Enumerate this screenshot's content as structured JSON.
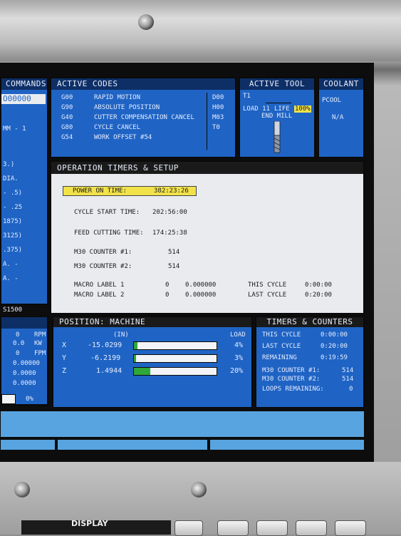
{
  "left_column": {
    "title": "COMMANDS",
    "code": "O00000",
    "lines": [
      "MM - 1",
      "3.)",
      "DIA.",
      "- .5)",
      "- .25",
      "1875)",
      "3125)",
      ".375)",
      "A. -",
      "A. -",
      "S1500"
    ]
  },
  "active_codes": {
    "title": "ACTIVE CODES",
    "rows": [
      {
        "code": "G00",
        "desc": "RAPID MOTION",
        "right": "D00"
      },
      {
        "code": "G90",
        "desc": "ABSOLUTE POSITION",
        "right": "H00"
      },
      {
        "code": "G40",
        "desc": "CUTTER COMPENSATION CANCEL",
        "right": "M03"
      },
      {
        "code": "G80",
        "desc": "CYCLE CANCEL",
        "right": "T0"
      },
      {
        "code": "G54",
        "desc": "WORK OFFSET #54",
        "right": ""
      }
    ]
  },
  "active_tool": {
    "title": "ACTIVE TOOL",
    "tool": "T1",
    "load_label": "LOAD 11",
    "life_label": "LIFE",
    "life_value": "100%",
    "tool_type": "END MILL"
  },
  "coolant": {
    "title": "COOLANT",
    "name": "PCOOL",
    "value": "N/A"
  },
  "operation": {
    "title": "OPERATION TIMERS & SETUP",
    "power_on_label": "POWER ON TIME:",
    "power_on_value": "382:23:26",
    "cycle_start_label": "CYCLE START TIME:",
    "cycle_start_value": "202:56:00",
    "feed_label": "FEED CUTTING TIME:",
    "feed_value": "174:25:38",
    "m30_1_label": "M30 COUNTER #1:",
    "m30_1_value": "514",
    "m30_2_label": "M30 COUNTER #2:",
    "m30_2_value": "514",
    "macro1_label": "MACRO LABEL 1",
    "macro1_num": "0",
    "macro1_value": "0.000000",
    "macro2_label": "MACRO LABEL 2",
    "macro2_num": "0",
    "macro2_value": "0.000000",
    "this_cycle_label": "THIS CYCLE",
    "this_cycle_value": "0:00:00",
    "last_cycle_label": "LAST CYCLE",
    "last_cycle_value": "0:20:00"
  },
  "spindle": {
    "rows": [
      {
        "value": "0",
        "unit": "RPM"
      },
      {
        "value": "0.0",
        "unit": "KW"
      },
      {
        "value": "0",
        "unit": "FPM"
      },
      {
        "value": "0.00000",
        "unit": ""
      },
      {
        "value": "0.0000",
        "unit": ""
      },
      {
        "value": "0.0000",
        "unit": ""
      }
    ],
    "percent": "0%"
  },
  "position": {
    "title": "POSITION: MACHINE",
    "unit_label": "(IN)",
    "load_label": "LOAD",
    "axes": [
      {
        "axis": "X",
        "value": "-15.0299",
        "load": "4%",
        "load_fraction": 0.04
      },
      {
        "axis": "Y",
        "value": "-6.2199",
        "load": "3%",
        "load_fraction": 0.03
      },
      {
        "axis": "Z",
        "value": "1.4944",
        "load": "20%",
        "load_fraction": 0.2
      }
    ]
  },
  "timers": {
    "title": "TIMERS & COUNTERS",
    "this_cycle_label": "THIS CYCLE",
    "this_cycle_value": "0:00:00",
    "last_cycle_label": "LAST CYCLE",
    "last_cycle_value": "0:20:00",
    "remaining_label": "REMAINING",
    "remaining_value": "0:19:59",
    "m30_1_label": "M30 COUNTER #1:",
    "m30_1_value": "514",
    "m30_2_label": "M30 COUNTER #2:",
    "m30_2_value": "514",
    "loops_label": "LOOPS REMAINING:",
    "loops_value": "0"
  },
  "keypad": {
    "display_label": "DISPLAY"
  },
  "colors": {
    "panel_blue": "#1f64c4",
    "title_dark": "#0e2f66",
    "highlight_yellow": "#f1e24a",
    "load_green": "#2fa83a"
  }
}
